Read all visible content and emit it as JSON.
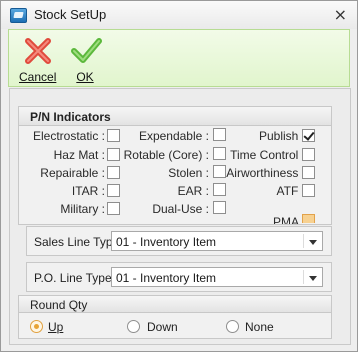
{
  "window": {
    "title": "Stock SetUp",
    "close_glyph": "×"
  },
  "toolbar": {
    "cancel_label": "Cancel",
    "ok_label": "OK"
  },
  "indicators": {
    "title": "P/N Indicators",
    "col1": [
      {
        "label": "Electrostatic :",
        "checked": false
      },
      {
        "label": "Haz Mat :",
        "checked": false
      },
      {
        "label": "Repairable :",
        "checked": false
      },
      {
        "label": "ITAR :",
        "checked": false
      },
      {
        "label": "Military :",
        "checked": false
      }
    ],
    "col2": [
      {
        "label": "Expendable :",
        "checked": false
      },
      {
        "label": "Rotable (Core) :",
        "checked": false
      },
      {
        "label": "Stolen :",
        "checked": false
      },
      {
        "label": "EAR :",
        "checked": false
      },
      {
        "label": "Dual-Use :",
        "checked": false
      }
    ],
    "col3": [
      {
        "label": "Publish :",
        "checked": true
      },
      {
        "label": "Time Control :",
        "checked": false
      },
      {
        "label": "Airworthiness :",
        "checked": false
      },
      {
        "label": "ATF :",
        "checked": false
      },
      {
        "label": "PMA :",
        "checked": false
      }
    ]
  },
  "sales_line_type": {
    "label": "Sales Line Type :",
    "value": "01 - Inventory Item"
  },
  "po_line_type": {
    "label": "P.O. Line Type :",
    "value": "01 - Inventory Item"
  },
  "round_qty": {
    "title": "Round Qty",
    "options": [
      "Up",
      "Down",
      "None"
    ],
    "selected": "Up"
  },
  "colors": {
    "toolbar_bg": "#e1f5cd",
    "selected_radio": "#e7a336",
    "cancel_icon": "#e04a3c",
    "ok_icon": "#5cb83c"
  }
}
